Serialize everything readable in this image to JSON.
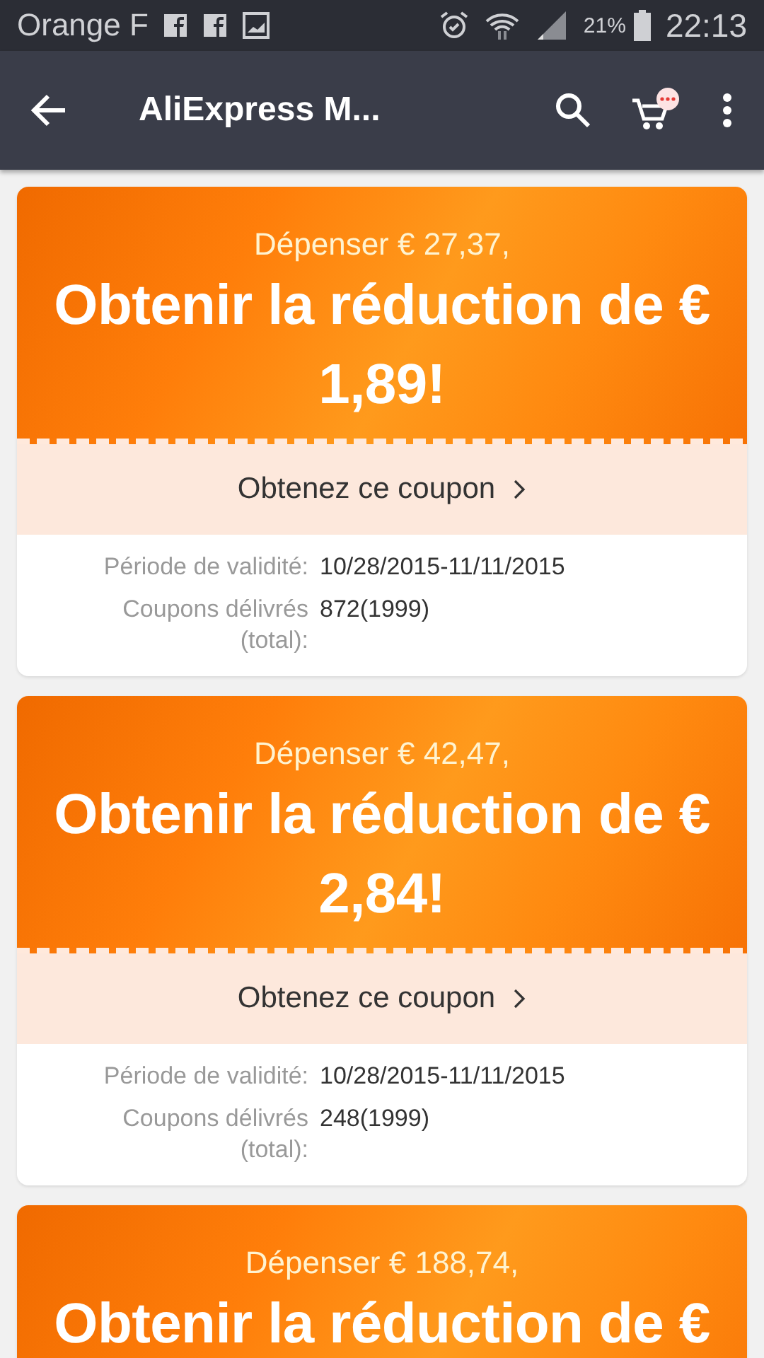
{
  "status_bar": {
    "carrier": "Orange F",
    "battery": "21%",
    "time": "22:13"
  },
  "app_bar": {
    "title": "AliExpress M..."
  },
  "coupons": [
    {
      "spend": "Dépenser € 27,37,",
      "discount": "Obtenir la réduction de € 1,89!",
      "action": "Obtenez ce coupon",
      "details": [
        {
          "label": "Période de validité:",
          "value": "10/28/2015-11/11/2015"
        },
        {
          "label": "Coupons délivrés (total):",
          "value": "872(1999)"
        }
      ]
    },
    {
      "spend": "Dépenser € 42,47,",
      "discount": "Obtenir la réduction de € 2,84!",
      "action": "Obtenez ce coupon",
      "details": [
        {
          "label": "Période de validité:",
          "value": "10/28/2015-11/11/2015"
        },
        {
          "label": "Coupons délivrés (total):",
          "value": "248(1999)"
        }
      ]
    },
    {
      "spend": "Dépenser € 188,74,",
      "discount": "Obtenir la réduction de €"
    }
  ]
}
